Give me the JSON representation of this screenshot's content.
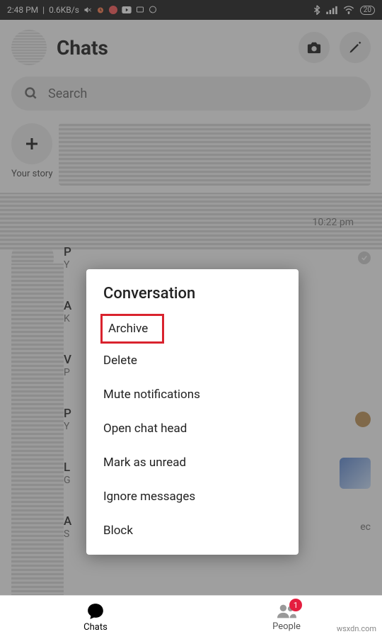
{
  "status": {
    "time": "2:48 PM",
    "net": "0.6KB/s",
    "battery": "20"
  },
  "header": {
    "title": "Chats"
  },
  "search": {
    "placeholder": "Search"
  },
  "story": {
    "your_label": "Your story"
  },
  "chat": {
    "row0_time": "10:22 pm",
    "row1_name": "P",
    "row1_sub": "Y",
    "row2_name": "A",
    "row2_sub": "K",
    "row3_name": "V",
    "row3_sub": "P",
    "row4_name": "P",
    "row4_sub": "Y",
    "row5_name": "L",
    "row5_sub": "G",
    "row6_name": "A",
    "row6_sub": "S",
    "row6_time": "ec"
  },
  "popup": {
    "title": "Conversation",
    "items": {
      "archive": "Archive",
      "delete": "Delete",
      "mute": "Mute notifications",
      "open_head": "Open chat head",
      "mark_unread": "Mark as unread",
      "ignore": "Ignore messages",
      "block": "Block"
    }
  },
  "nav": {
    "chats": "Chats",
    "people": "People",
    "people_badge": "1"
  },
  "watermark": "wsxdn.com"
}
